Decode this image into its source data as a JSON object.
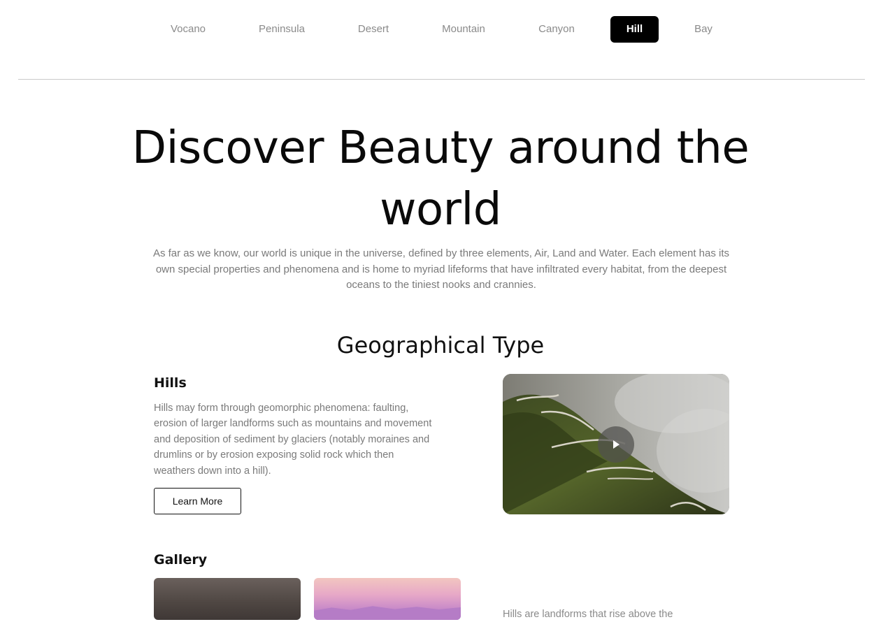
{
  "nav": {
    "items": [
      {
        "label": "Vocano",
        "active": false
      },
      {
        "label": "Peninsula",
        "active": false
      },
      {
        "label": "Desert",
        "active": false
      },
      {
        "label": "Mountain",
        "active": false
      },
      {
        "label": "Canyon",
        "active": false
      },
      {
        "label": "Hill",
        "active": true
      },
      {
        "label": "Bay",
        "active": false
      }
    ]
  },
  "hero": {
    "title": "Discover Beauty around the world",
    "subtitle": "As far as we know, our world is unique in the universe, defined by three elements, Air, Land and Water. Each element has its own special properties and phenomena and is home to myriad lifeforms that have infiltrated every habitat, from the deepest oceans to the tiniest nooks and crannies."
  },
  "section": {
    "title": "Geographical Type"
  },
  "hills": {
    "heading": "Hills",
    "text": "Hills may form through geomorphic phenomena: faulting, erosion of larger landforms such as mountains and movement and deposition of sediment by glaciers (notably moraines and drumlins or by erosion exposing solid rock which then weathers down into a hill).",
    "button_label": "Learn More",
    "video_icon": "play-icon"
  },
  "gallery": {
    "heading": "Gallery",
    "caption": "Hills are landforms that rise above the"
  },
  "colors": {
    "active_bg": "#000000",
    "active_text": "#ffffff",
    "muted_text": "#8a8a8a"
  }
}
